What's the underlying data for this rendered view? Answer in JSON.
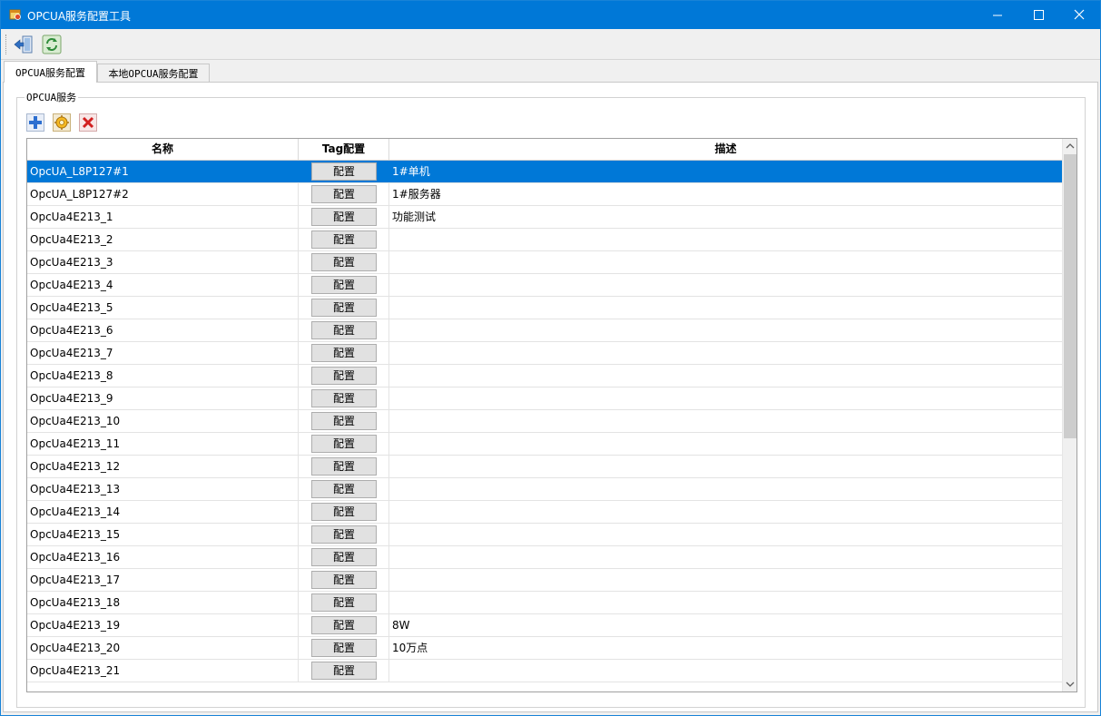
{
  "window": {
    "title": "OPCUA服务配置工具"
  },
  "toolbar": {
    "exit_icon": "exit-icon",
    "refresh_icon": "refresh-icon"
  },
  "tabs": [
    {
      "label": "OPCUA服务配置",
      "active": true
    },
    {
      "label": "本地OPCUA服务配置",
      "active": false
    }
  ],
  "group": {
    "title": "OPCUA服务"
  },
  "actions": {
    "add_icon": "add-icon",
    "config_icon": "gear-icon",
    "delete_icon": "delete-icon"
  },
  "grid": {
    "headers": {
      "name": "名称",
      "tag": "Tag配置",
      "desc": "描述"
    },
    "button_label": "配置",
    "selected_row": 0,
    "rows": [
      {
        "name": "OpcUA_L8P127#1",
        "desc": "1#单机"
      },
      {
        "name": "OpcUA_L8P127#2",
        "desc": "1#服务器"
      },
      {
        "name": "OpcUa4E213_1",
        "desc": "功能测试"
      },
      {
        "name": "OpcUa4E213_2",
        "desc": ""
      },
      {
        "name": "OpcUa4E213_3",
        "desc": ""
      },
      {
        "name": "OpcUa4E213_4",
        "desc": ""
      },
      {
        "name": "OpcUa4E213_5",
        "desc": ""
      },
      {
        "name": "OpcUa4E213_6",
        "desc": ""
      },
      {
        "name": "OpcUa4E213_7",
        "desc": ""
      },
      {
        "name": "OpcUa4E213_8",
        "desc": ""
      },
      {
        "name": "OpcUa4E213_9",
        "desc": ""
      },
      {
        "name": "OpcUa4E213_10",
        "desc": ""
      },
      {
        "name": "OpcUa4E213_11",
        "desc": ""
      },
      {
        "name": "OpcUa4E213_12",
        "desc": ""
      },
      {
        "name": "OpcUa4E213_13",
        "desc": ""
      },
      {
        "name": "OpcUa4E213_14",
        "desc": ""
      },
      {
        "name": "OpcUa4E213_15",
        "desc": ""
      },
      {
        "name": "OpcUa4E213_16",
        "desc": ""
      },
      {
        "name": "OpcUa4E213_17",
        "desc": ""
      },
      {
        "name": "OpcUa4E213_18",
        "desc": ""
      },
      {
        "name": "OpcUa4E213_19",
        "desc": "8W"
      },
      {
        "name": "OpcUa4E213_20",
        "desc": "10万点"
      },
      {
        "name": "OpcUa4E213_21",
        "desc": ""
      }
    ]
  },
  "colors": {
    "titlebar": "#0078d7",
    "selection": "#0078d7",
    "button_face": "#e1e1e1"
  }
}
